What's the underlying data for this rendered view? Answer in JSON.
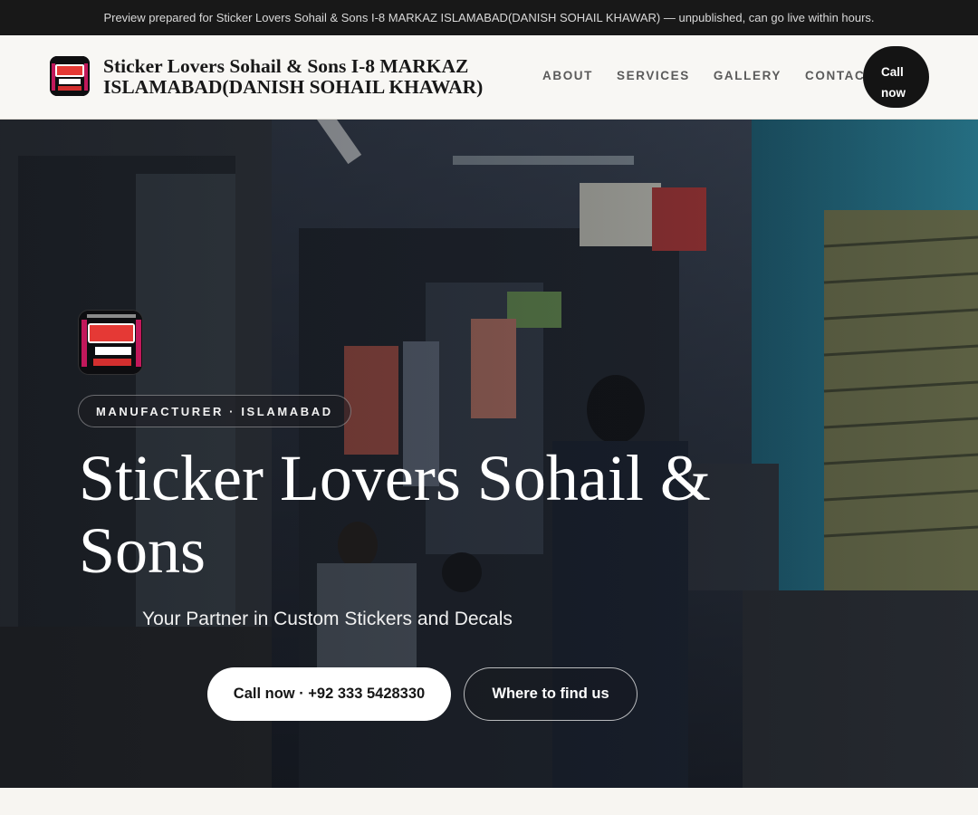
{
  "notice": {
    "text": "Preview prepared for Sticker Lovers Sohail & Sons I-8 MARKAZ ISLAMABAD(DANISH SOHAIL KHAWAR) — unpublished, can go live within hours."
  },
  "header": {
    "brand_name": "Sticker Lovers Sohail & Sons I-8 MARKAZ ISLAMABAD(DANISH SOHAIL KHAWAR)",
    "logo_icon": "sticker-lovers-logo-icon",
    "nav": [
      {
        "label": "ABOUT"
      },
      {
        "label": "SERVICES"
      },
      {
        "label": "GALLERY"
      },
      {
        "label": "CONTACT"
      }
    ],
    "call_button": "Call now"
  },
  "hero": {
    "logo_icon": "sticker-lovers-logo-icon",
    "badge": "MANUFACTURER · ISLAMABAD",
    "title": "Sticker Lovers Sohail & Sons",
    "subtitle": "Your Partner in Custom Stickers and Decals",
    "primary_button": "Call now · +92 333 5428330",
    "secondary_button": "Where to find us",
    "background_image": "market-alley-photo"
  },
  "colors": {
    "notice_bg": "#181818",
    "header_bg": "#f8f7f4",
    "accent_dark": "#141414",
    "hero_text": "#ffffff"
  }
}
